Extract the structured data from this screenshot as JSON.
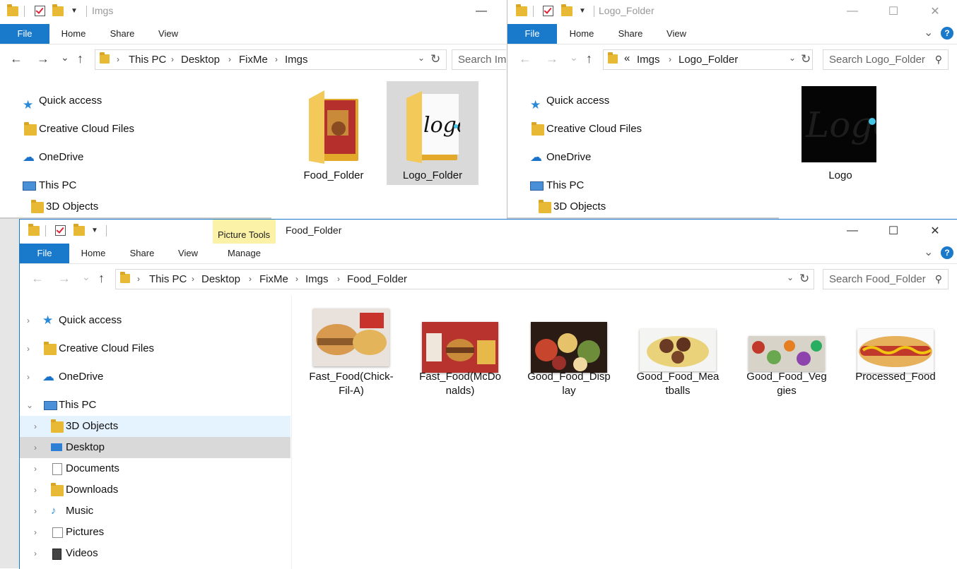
{
  "imgs_window": {
    "title": "Imgs",
    "tabs": [
      "File",
      "Home",
      "Share",
      "View"
    ],
    "breadcrumb": [
      "This PC",
      "Desktop",
      "FixMe",
      "Imgs"
    ],
    "search_placeholder": "Search Imgs",
    "nav": [
      "Quick access",
      "Creative Cloud Files",
      "OneDrive",
      "This PC",
      "3D Objects"
    ],
    "items": [
      "Food_Folder",
      "Logo_Folder"
    ]
  },
  "logo_window": {
    "title": "Logo_Folder",
    "tabs": [
      "File",
      "Home",
      "Share",
      "View"
    ],
    "breadcrumb_prefix": "«",
    "breadcrumb": [
      "Imgs",
      "Logo_Folder"
    ],
    "search_placeholder": "Search Logo_Folder",
    "nav": [
      "Quick access",
      "Creative Cloud Files",
      "OneDrive",
      "This PC",
      "3D Objects"
    ],
    "items": [
      "Logo"
    ]
  },
  "food_window": {
    "title": "Food_Folder",
    "context_tab_group": "Picture Tools",
    "tabs": [
      "File",
      "Home",
      "Share",
      "View",
      "Manage"
    ],
    "breadcrumb": [
      "This PC",
      "Desktop",
      "FixMe",
      "Imgs",
      "Food_Folder"
    ],
    "search_placeholder": "Search Food_Folder",
    "nav": [
      "Quick access",
      "Creative Cloud Files",
      "OneDrive",
      "This PC",
      "3D Objects",
      "Desktop",
      "Documents",
      "Downloads",
      "Music",
      "Pictures",
      "Videos"
    ],
    "files": [
      {
        "line1": "Fast_Food(Chick-",
        "line2": "Fil-A)"
      },
      {
        "line1": "Fast_Food(McDo",
        "line2": "nalds)"
      },
      {
        "line1": "Good_Food_Disp",
        "line2": "lay"
      },
      {
        "line1": "Good_Food_Mea",
        "line2": "tballs"
      },
      {
        "line1": "Good_Food_Veg",
        "line2": "gies"
      },
      {
        "line1": "Processed_Food",
        "line2": ""
      }
    ]
  },
  "icons": {
    "back": "←",
    "forward": "→",
    "recent": "⌄",
    "up": "↑",
    "refresh": "↻",
    "search": "⚲",
    "minimize": "—",
    "maximize": "☐",
    "close": "✕",
    "help": "?",
    "ribbon_collapse": "⌄"
  },
  "colors": {
    "accent": "#1979ca",
    "selected": "#cce8ff",
    "picture_tools": "#fbf2a7"
  }
}
